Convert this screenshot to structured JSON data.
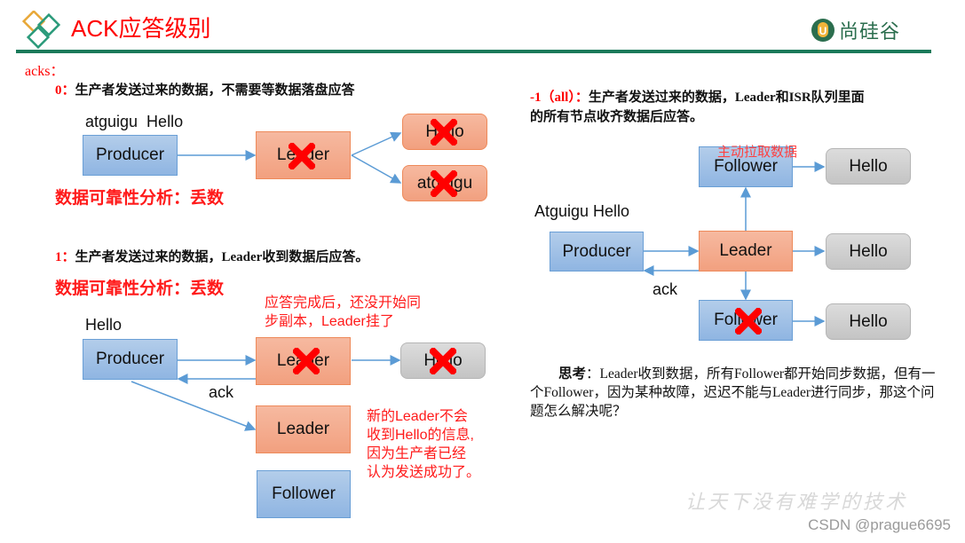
{
  "header": {
    "title": "ACK应答级别",
    "brand": "尚硅谷",
    "brand_badge": "U",
    "colors": {
      "title": "#ff0000",
      "rule": "#1b7a5a",
      "brand": "#2b6e4e"
    }
  },
  "acks_label": "acks：",
  "section_0": {
    "num": "0：",
    "text": "生产者发送过来的数据，不需要等数据落盘应答",
    "messages_label": "atguigu  Hello",
    "producer": "Producer",
    "leader": "Leader",
    "targets": [
      "Hello",
      "atguigu"
    ],
    "reliability": "数据可靠性分析：丢数"
  },
  "section_1": {
    "num": "1：",
    "text": "生产者发送过来的数据，Leader收到数据后应答。",
    "reliability": "数据可靠性分析：丢数",
    "messages_label": "Hello",
    "producer": "Producer",
    "leader_failed": "Leader",
    "target": "Hello",
    "ack_label": "ack",
    "new_leader": "Leader",
    "follower": "Follower",
    "note_top": [
      "应答完成后，还没开始同",
      "步副本，Leader挂了"
    ],
    "note_right": [
      "新的Leader不会",
      "收到Hello的信息,",
      "因为生产者已经",
      "认为发送成功了。"
    ]
  },
  "section_all": {
    "num": "-1（all）：",
    "text_line1": "生产者发送过来的数据，Leader和ISR队列里面",
    "text_line2": "的所有节点收齐数据后应答。",
    "pull_note": "主动拉取数据",
    "messages_label": "Atguigu Hello",
    "producer": "Producer",
    "leader": "Leader",
    "follower_top": "Follower",
    "follower_bottom": "Follower",
    "targets": [
      "Hello",
      "Hello",
      "Hello"
    ],
    "ack_label": "ack"
  },
  "thinking": {
    "label": "思考",
    "text": "：Leader收到数据，所有Follower都开始同步数据，但有一个Follower，因为某种故障，迟迟不能与Leader进行同步，那这个问题怎么解决呢？"
  },
  "watermark": {
    "slogan": "让天下没有难学的技术",
    "credit": "CSDN @prague6695"
  }
}
